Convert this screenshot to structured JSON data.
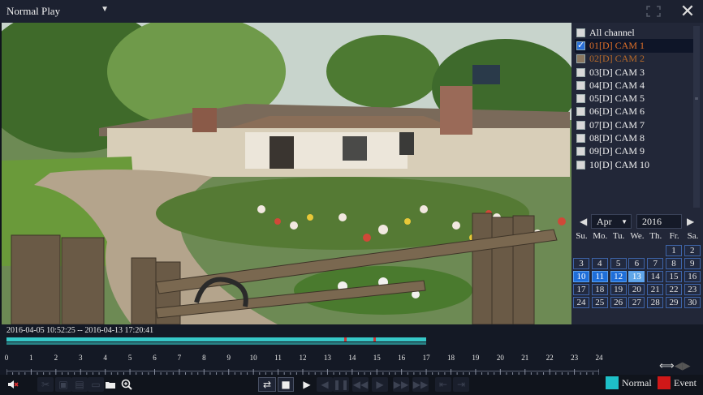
{
  "header": {
    "mode": "Normal Play",
    "fullscreen_icon": "fullscreen-icon",
    "close_icon": "close-icon"
  },
  "channels": [
    {
      "label": "All channel",
      "checked": false
    },
    {
      "label": "01[D] CAM 1",
      "checked": true,
      "selected": true
    },
    {
      "label": "02[D] CAM 2",
      "checked": false,
      "hover": true
    },
    {
      "label": "03[D] CAM 3",
      "checked": false
    },
    {
      "label": "04[D] CAM 4",
      "checked": false
    },
    {
      "label": "05[D] CAM 5",
      "checked": false
    },
    {
      "label": "06[D] CAM 6",
      "checked": false
    },
    {
      "label": "07[D] CAM 7",
      "checked": false
    },
    {
      "label": "08[D] CAM 8",
      "checked": false
    },
    {
      "label": "09[D] CAM 9",
      "checked": false
    },
    {
      "label": "10[D] CAM 10",
      "checked": false
    }
  ],
  "calendar": {
    "month": "Apr",
    "year": "2016",
    "weekdays": [
      "Su.",
      "Mo.",
      "Tu.",
      "We.",
      "Th.",
      "Fr.",
      "Sa."
    ],
    "leading_blanks": 5,
    "days_in_month": 30,
    "recorded_days": [
      10,
      11,
      12,
      13
    ],
    "selected_day": 13
  },
  "timeline": {
    "range": "2016-04-05 10:52:25 -- 2016-04-13 17:20:41",
    "hours": [
      "0",
      "1",
      "2",
      "3",
      "4",
      "5",
      "6",
      "7",
      "8",
      "9",
      "10",
      "11",
      "12",
      "13",
      "14",
      "15",
      "16",
      "17",
      "18",
      "19",
      "20",
      "21",
      "22",
      "23",
      "24"
    ],
    "recorded_until_hour": 17
  },
  "legend": {
    "normal_label": "Normal",
    "normal_color": "#1ec0c8",
    "event_label": "Event",
    "event_color": "#d01818"
  },
  "colors": {
    "accent": "#1f6ed8",
    "selected_text": "#e07028"
  }
}
